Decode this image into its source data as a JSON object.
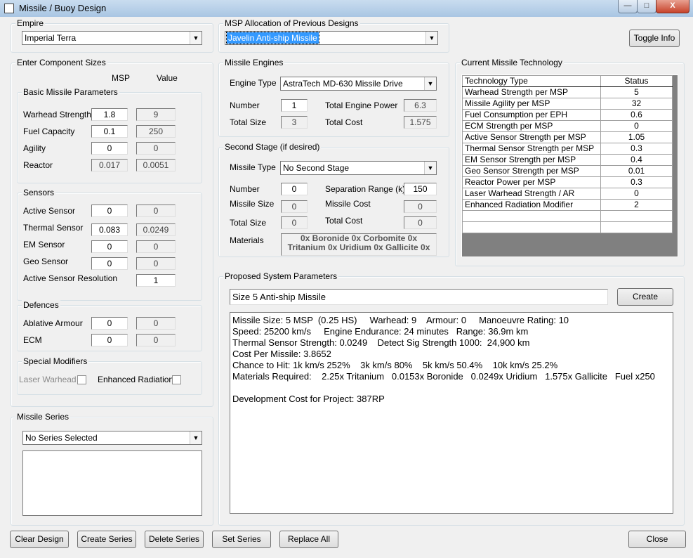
{
  "window": {
    "title": "Missile / Buoy Design",
    "controls": {
      "minimize": "—",
      "maximize": "□",
      "close": "X"
    }
  },
  "empire": {
    "label": "Empire",
    "value": "Imperial Terra"
  },
  "msp_alloc": {
    "label": "MSP Allocation of Previous Designs",
    "value": "Javelin Anti-ship Missile"
  },
  "toggle_info": "Toggle Info",
  "components": {
    "label": "Enter Component Sizes",
    "col_msp": "MSP",
    "col_value": "Value",
    "basic": {
      "label": "Basic Missile Parameters",
      "rows": [
        {
          "name": "Warhead Strength",
          "msp": "1.8",
          "value": "9"
        },
        {
          "name": "Fuel Capacity",
          "msp": "0.1",
          "value": "250"
        },
        {
          "name": "Agility",
          "msp": "0",
          "value": "0"
        },
        {
          "name": "Reactor",
          "msp": "0.017",
          "value": "0.0051"
        }
      ]
    },
    "sensors": {
      "label": "Sensors",
      "rows": [
        {
          "name": "Active Sensor",
          "msp": "0",
          "value": "0"
        },
        {
          "name": "Thermal Sensor",
          "msp": "0.083",
          "value": "0.0249"
        },
        {
          "name": "EM Sensor",
          "msp": "0",
          "value": "0"
        },
        {
          "name": "Geo Sensor",
          "msp": "0",
          "value": "0"
        }
      ],
      "resolution_label": "Active Sensor Resolution",
      "resolution_value": "1"
    },
    "defences": {
      "label": "Defences",
      "rows": [
        {
          "name": "Ablative Armour",
          "msp": "0",
          "value": "0"
        },
        {
          "name": "ECM",
          "msp": "0",
          "value": "0"
        }
      ]
    },
    "special": {
      "label": "Special Modifiers",
      "laser": "Laser Warhead",
      "enhanced": "Enhanced Radiation"
    }
  },
  "engines": {
    "label": "Missile Engines",
    "engine_type_label": "Engine Type",
    "engine_type": "AstraTech MD-630 Missile Drive",
    "number_label": "Number",
    "number": "1",
    "total_power_label": "Total Engine Power",
    "total_power": "6.3",
    "total_size_label": "Total Size",
    "total_size": "3",
    "total_cost_label": "Total Cost",
    "total_cost": "1.575"
  },
  "second_stage": {
    "label": "Second Stage (if desired)",
    "missile_type_label": "Missile Type",
    "missile_type": "No Second Stage",
    "number_label": "Number",
    "number": "0",
    "sep_range_label": "Separation Range (k)",
    "sep_range": "150",
    "missile_size_label": "Missile Size",
    "missile_size": "0",
    "missile_cost_label": "Missile Cost",
    "missile_cost": "0",
    "total_size_label": "Total Size",
    "total_size": "0",
    "total_cost_label": "Total Cost",
    "total_cost": "0",
    "materials_label": "Materials",
    "materials_line1": "0x Boronide  0x Corbomite  0x",
    "materials_line2": "Tritanium  0x Uridium  0x Gallicite 0x"
  },
  "tech": {
    "label": "Current Missile Technology",
    "headers": [
      "Technology Type",
      "Status"
    ],
    "rows": [
      [
        "Warhead Strength per MSP",
        "5"
      ],
      [
        "Missile Agility per MSP",
        "32"
      ],
      [
        "Fuel Consumption per EPH",
        "0.6"
      ],
      [
        "ECM Strength per MSP",
        "0"
      ],
      [
        "Active Sensor Strength per MSP",
        "1.05"
      ],
      [
        "Thermal Sensor Strength per MSP",
        "0.3"
      ],
      [
        "EM Sensor Strength per MSP",
        "0.4"
      ],
      [
        "Geo Sensor Strength per MSP",
        "0.01"
      ],
      [
        "Reactor Power per MSP",
        "0.3"
      ],
      [
        "Laser Warhead Strength / AR",
        "0"
      ],
      [
        "Enhanced Radiation Modifier",
        "2"
      ]
    ]
  },
  "proposed": {
    "label": "Proposed System Parameters",
    "name": "Size 5 Anti-ship Missile",
    "create": "Create",
    "lines": [
      "Missile Size: 5 MSP  (0.25 HS)     Warhead: 9    Armour: 0     Manoeuvre Rating: 10",
      "Speed: 25200 km/s     Engine Endurance: 24 minutes   Range: 36.9m km",
      "Thermal Sensor Strength: 0.0249    Detect Sig Strength 1000:  24,900 km",
      "Cost Per Missile: 3.8652",
      "Chance to Hit: 1k km/s 252%    3k km/s 80%    5k km/s 50.4%    10k km/s 25.2%",
      "Materials Required:    2.25x Tritanium   0.0153x Boronide   0.0249x Uridium   1.575x Gallicite   Fuel x250",
      "",
      "Development Cost for Project: 387RP"
    ]
  },
  "series": {
    "label": "Missile Series",
    "value": "No Series Selected"
  },
  "buttons": {
    "clear": "Clear Design",
    "create_series": "Create Series",
    "delete_series": "Delete Series",
    "set_series": "Set Series",
    "replace_all": "Replace All",
    "close": "Close"
  },
  "colors": {
    "titlebar": "#b8d0ea",
    "selection": "#3399ff",
    "grid_bg": "#808080"
  }
}
